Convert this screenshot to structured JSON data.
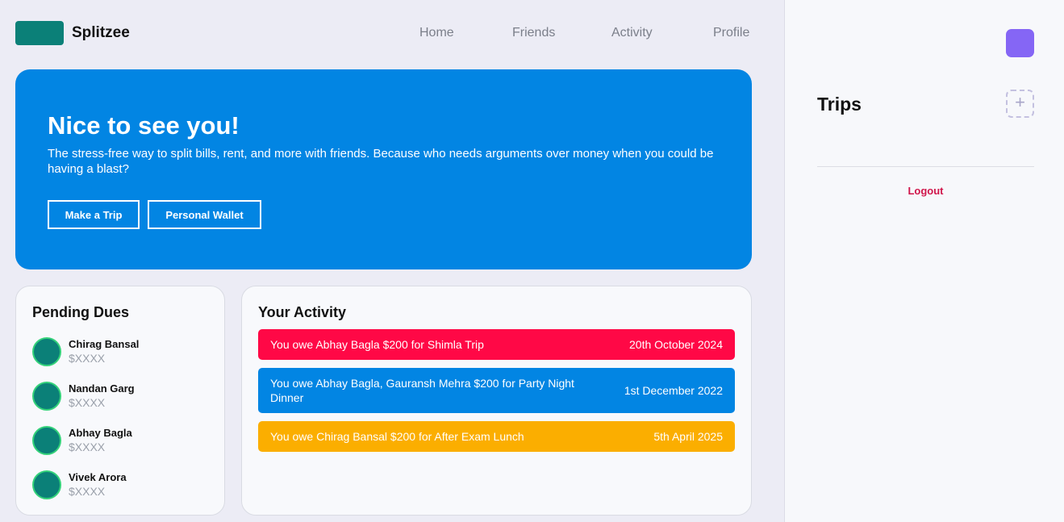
{
  "header": {
    "app_name": "Splitzee",
    "logo_color": "#0b8078",
    "nav": [
      "Home",
      "Friends",
      "Activity",
      "Profile"
    ]
  },
  "hero": {
    "title": "Nice to see you!",
    "text": "The stress-free way to split bills, rent, and more with friends. Because who needs arguments over money when you could be having a blast?",
    "buttons": [
      "Make a Trip",
      "Personal Wallet"
    ],
    "color": "#0285e3"
  },
  "pending_dues": {
    "title": "Pending Dues",
    "items": [
      {
        "name": "Chirag Bansal",
        "amount": "$XXXX"
      },
      {
        "name": "Nandan Garg",
        "amount": "$XXXX"
      },
      {
        "name": "Abhay Bagla",
        "amount": "$XXXX"
      },
      {
        "name": "Vivek Arora",
        "amount": "$XXXX"
      }
    ]
  },
  "activity": {
    "title": "Your Activity",
    "items": [
      {
        "text": "You owe Abhay Bagla $200 for Shimla Trip",
        "date": "20th October 2024",
        "color": "#ff0846"
      },
      {
        "text": "You owe Abhay Bagla, Gauransh Mehra $200 for Party Night Dinner",
        "date": "1st December 2022",
        "color": "#0285e3"
      },
      {
        "text": "You owe Chirag Bansal $200 for After Exam Lunch",
        "date": "5th April 2025",
        "color": "#fbae00"
      }
    ]
  },
  "sidebar": {
    "avatar_color": "#8566f5",
    "trips_title": "Trips",
    "add_icon": "plus-icon",
    "logout_label": "Logout"
  }
}
